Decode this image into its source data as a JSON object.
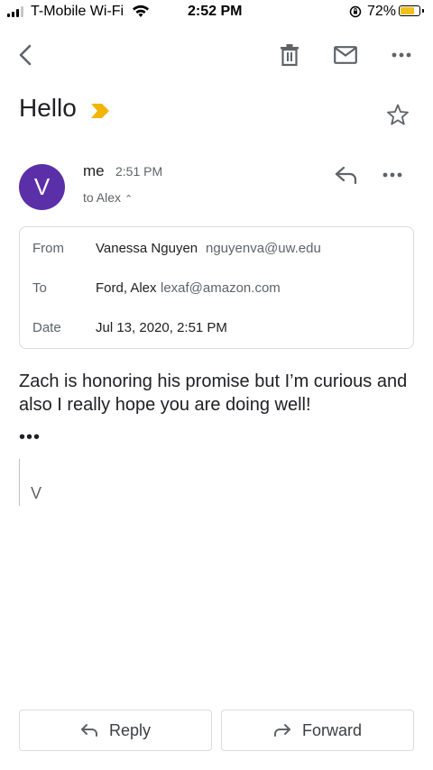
{
  "status_bar": {
    "carrier": "T-Mobile Wi-Fi",
    "time": "2:52 PM",
    "battery": "72%",
    "battery_level": 0.72,
    "icons": [
      "signal-icon",
      "wifi-icon",
      "rotation-lock-icon",
      "battery-icon"
    ]
  },
  "toolbar": {
    "icons": [
      "back-icon",
      "trash-icon",
      "mail-icon",
      "more-icon"
    ]
  },
  "email": {
    "subject": "Hello",
    "label_icon": "importance-marker-icon",
    "label_color": "#f4b400",
    "avatar_letter": "V",
    "avatar_color": "#5b2fa8",
    "sender": "me",
    "time": "2:51 PM",
    "to_summary": "to Alex",
    "details": {
      "from_label": "From",
      "from_name": "Vanessa Nguyen",
      "from_email": "nguyenva@uw.edu",
      "to_label": "To",
      "to_name": "Ford, Alex",
      "to_email": "lexaf@amazon.com",
      "date_label": "Date",
      "date_value": "Jul 13, 2020, 2:51 PM"
    },
    "body": "Zach is honoring his promise but I’m curious and also I really hope you are doing well!",
    "ellipsis": "•••",
    "signature": "V"
  },
  "actions": {
    "reply": "Reply",
    "forward": "Forward"
  }
}
